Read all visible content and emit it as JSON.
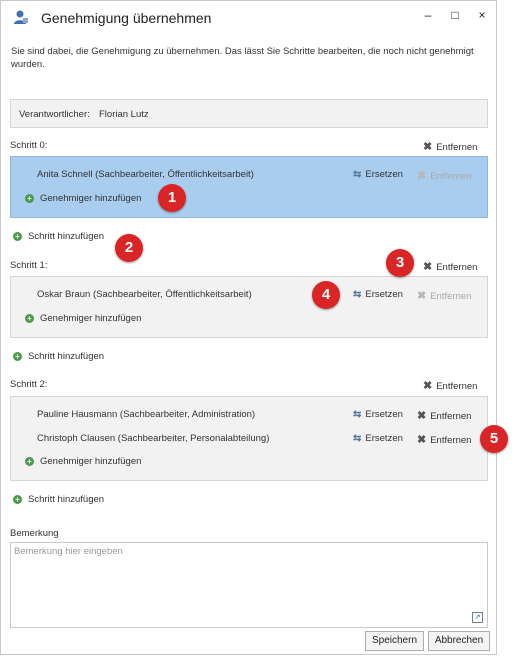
{
  "window": {
    "title": "Genehmigung übernehmen",
    "minimize": "–",
    "maximize": "□",
    "close": "×"
  },
  "intro_text": "Sie sind dabei, die Genehmigung zu übernehmen. Das lässt Sie Schritte bearbeiten, die noch nicht genehmigt wurden.",
  "responsible": {
    "label": "Verantwortlicher:",
    "name": "Florian Lutz"
  },
  "steps": [
    {
      "label": "Schritt 0:",
      "remove": "Entfernen",
      "approvers": [
        {
          "name": "Anita Schnell (Sachbearbeiter, Öffentlichkeitsarbeit)",
          "replace": "Ersetzen",
          "remove": "Entfernen",
          "remove_enabled": false
        }
      ],
      "add_approver": "Genehmiger hinzufügen",
      "selected": true
    },
    {
      "label": "Schritt 1:",
      "remove": "Entfernen",
      "approvers": [
        {
          "name": "Oskar Braun (Sachbearbeiter, Öffentlichkeitsarbeit)",
          "replace": "Ersetzen",
          "remove": "Entfernen",
          "remove_enabled": false
        }
      ],
      "add_approver": "Genehmiger hinzufügen",
      "selected": false
    },
    {
      "label": "Schritt 2:",
      "remove": "Entfernen",
      "approvers": [
        {
          "name": "Pauline Hausmann (Sachbearbeiter, Administration)",
          "replace": "Ersetzen",
          "remove": "Entfernen",
          "remove_enabled": true
        },
        {
          "name": "Christoph Clausen (Sachbearbeiter, Personalabteilung)",
          "replace": "Ersetzen",
          "remove": "Entfernen",
          "remove_enabled": true
        }
      ],
      "add_approver": "Genehmiger hinzufügen",
      "selected": false
    }
  ],
  "add_step": "Schritt hinzufügen",
  "remark": {
    "label": "Bemerkung",
    "placeholder": "Bemerkung hier eingeben"
  },
  "buttons": {
    "save": "Speichern",
    "cancel": "Abbrechen"
  },
  "callouts": [
    "1",
    "2",
    "3",
    "4",
    "5"
  ],
  "colors": {
    "selected_row": "#a9cdef",
    "callout": "#d92525",
    "add_icon": "#4a9a4a"
  }
}
